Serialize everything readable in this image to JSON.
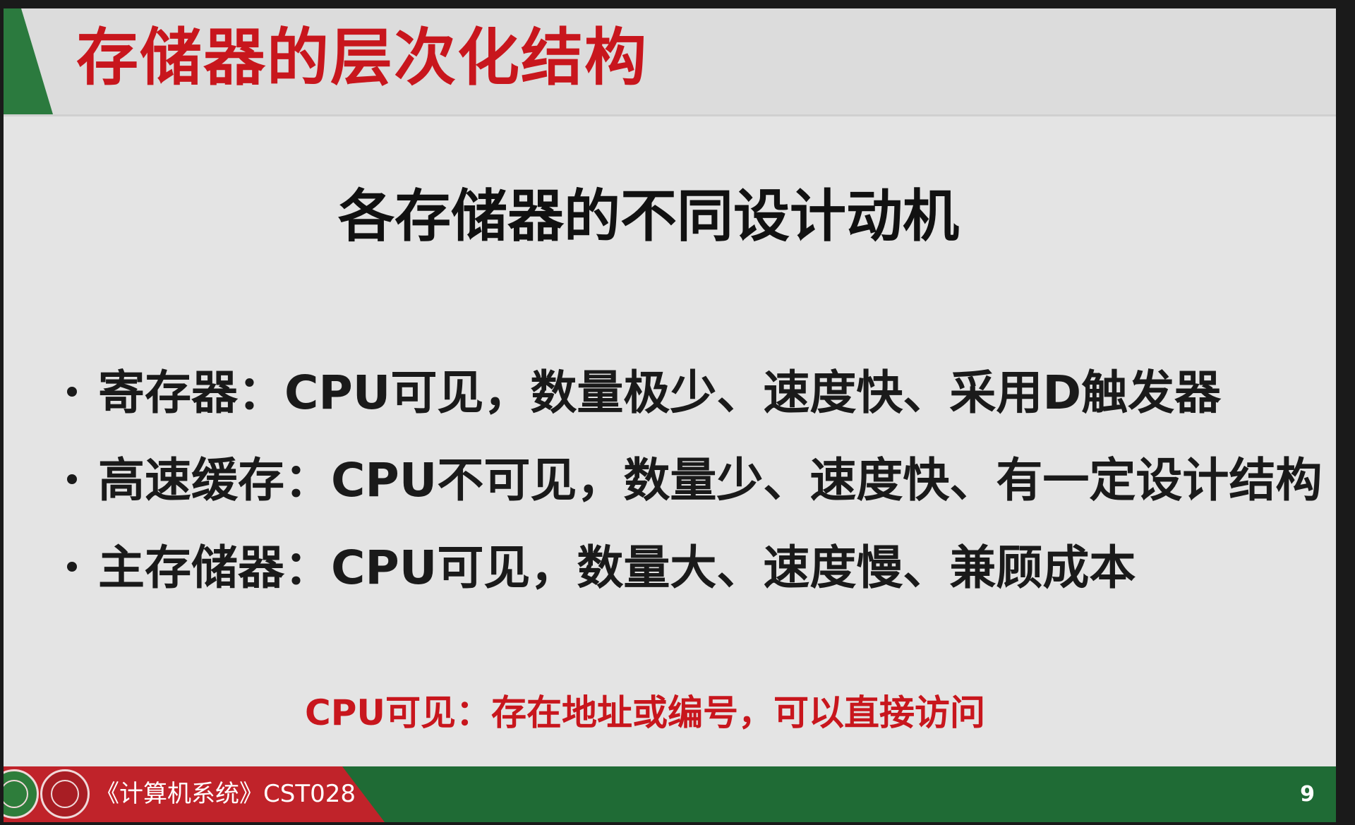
{
  "header": {
    "title": "存储器的层次化结构"
  },
  "subtitle": "各存储器的不同设计动机",
  "bullets": [
    {
      "text": "寄存器：CPU可见，数量极少、速度快、采用D触发器"
    },
    {
      "text": "高速缓存：CPU不可见，数量少、速度快、有一定设计结构"
    },
    {
      "text": "主存储器：CPU可见，数量大、速度慢、兼顾成本"
    }
  ],
  "note": "CPU可见：存在地址或编号，可以直接访问",
  "footer": {
    "course": "《计算机系统》CST028",
    "page_number": "9"
  },
  "colors": {
    "title_red": "#c8161d",
    "accent_green": "#1f6b35",
    "footer_red": "#c0232a",
    "slide_bg": "#e4e4e4"
  }
}
